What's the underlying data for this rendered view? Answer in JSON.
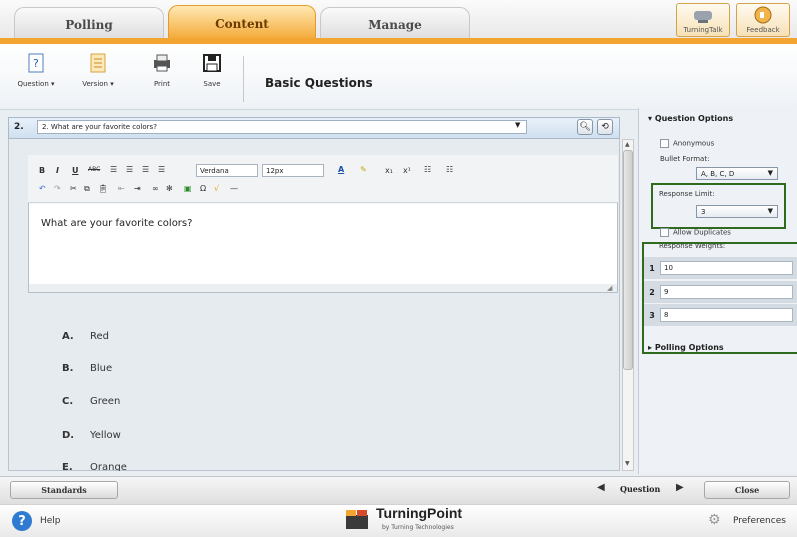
{
  "tabs": [
    {
      "label": "Polling"
    },
    {
      "label": "Content"
    },
    {
      "label": "Manage"
    }
  ],
  "top_right": {
    "turningtalk_label": "TurningTalk",
    "feedback_label": "Feedback"
  },
  "toolbar": {
    "question_label": "Question",
    "version_label": "Version",
    "print_label": "Print",
    "save_label": "Save",
    "page_title": "Basic Questions"
  },
  "question": {
    "number": "2.",
    "selected": "2. What are your favorite colors?",
    "body": "What are your favorite colors?"
  },
  "editor": {
    "font": "Verdana",
    "size": "12px"
  },
  "answers": [
    {
      "letter": "A.",
      "text": "Red"
    },
    {
      "letter": "B.",
      "text": "Blue"
    },
    {
      "letter": "C.",
      "text": "Green"
    },
    {
      "letter": "D.",
      "text": "Yellow"
    },
    {
      "letter": "E.",
      "text": "Orange"
    }
  ],
  "options": {
    "question_options_title": "Question Options",
    "anonymous_label": "Anonymous",
    "bullet_format_label": "Bullet Format:",
    "bullet_format_value": "A, B, C, D",
    "response_limit_label": "Response Limit:",
    "response_limit_value": "3",
    "allow_duplicates_label": "Allow Duplicates",
    "response_weights_label": "Response Weights:",
    "weights": [
      {
        "n": "1",
        "value": "10"
      },
      {
        "n": "2",
        "value": "9"
      },
      {
        "n": "3",
        "value": "8"
      }
    ],
    "polling_options_title": "Polling Options"
  },
  "bottom": {
    "standards_label": "Standards",
    "question_nav_label": "Question",
    "close_label": "Close"
  },
  "footer": {
    "help_label": "Help",
    "brand_main": "TurningPoint",
    "brand_sub": "by Turning Technologies",
    "preferences_label": "Preferences"
  },
  "colors": {
    "accent_orange": "#f3a531",
    "highlight_green": "#2e6b1f"
  }
}
